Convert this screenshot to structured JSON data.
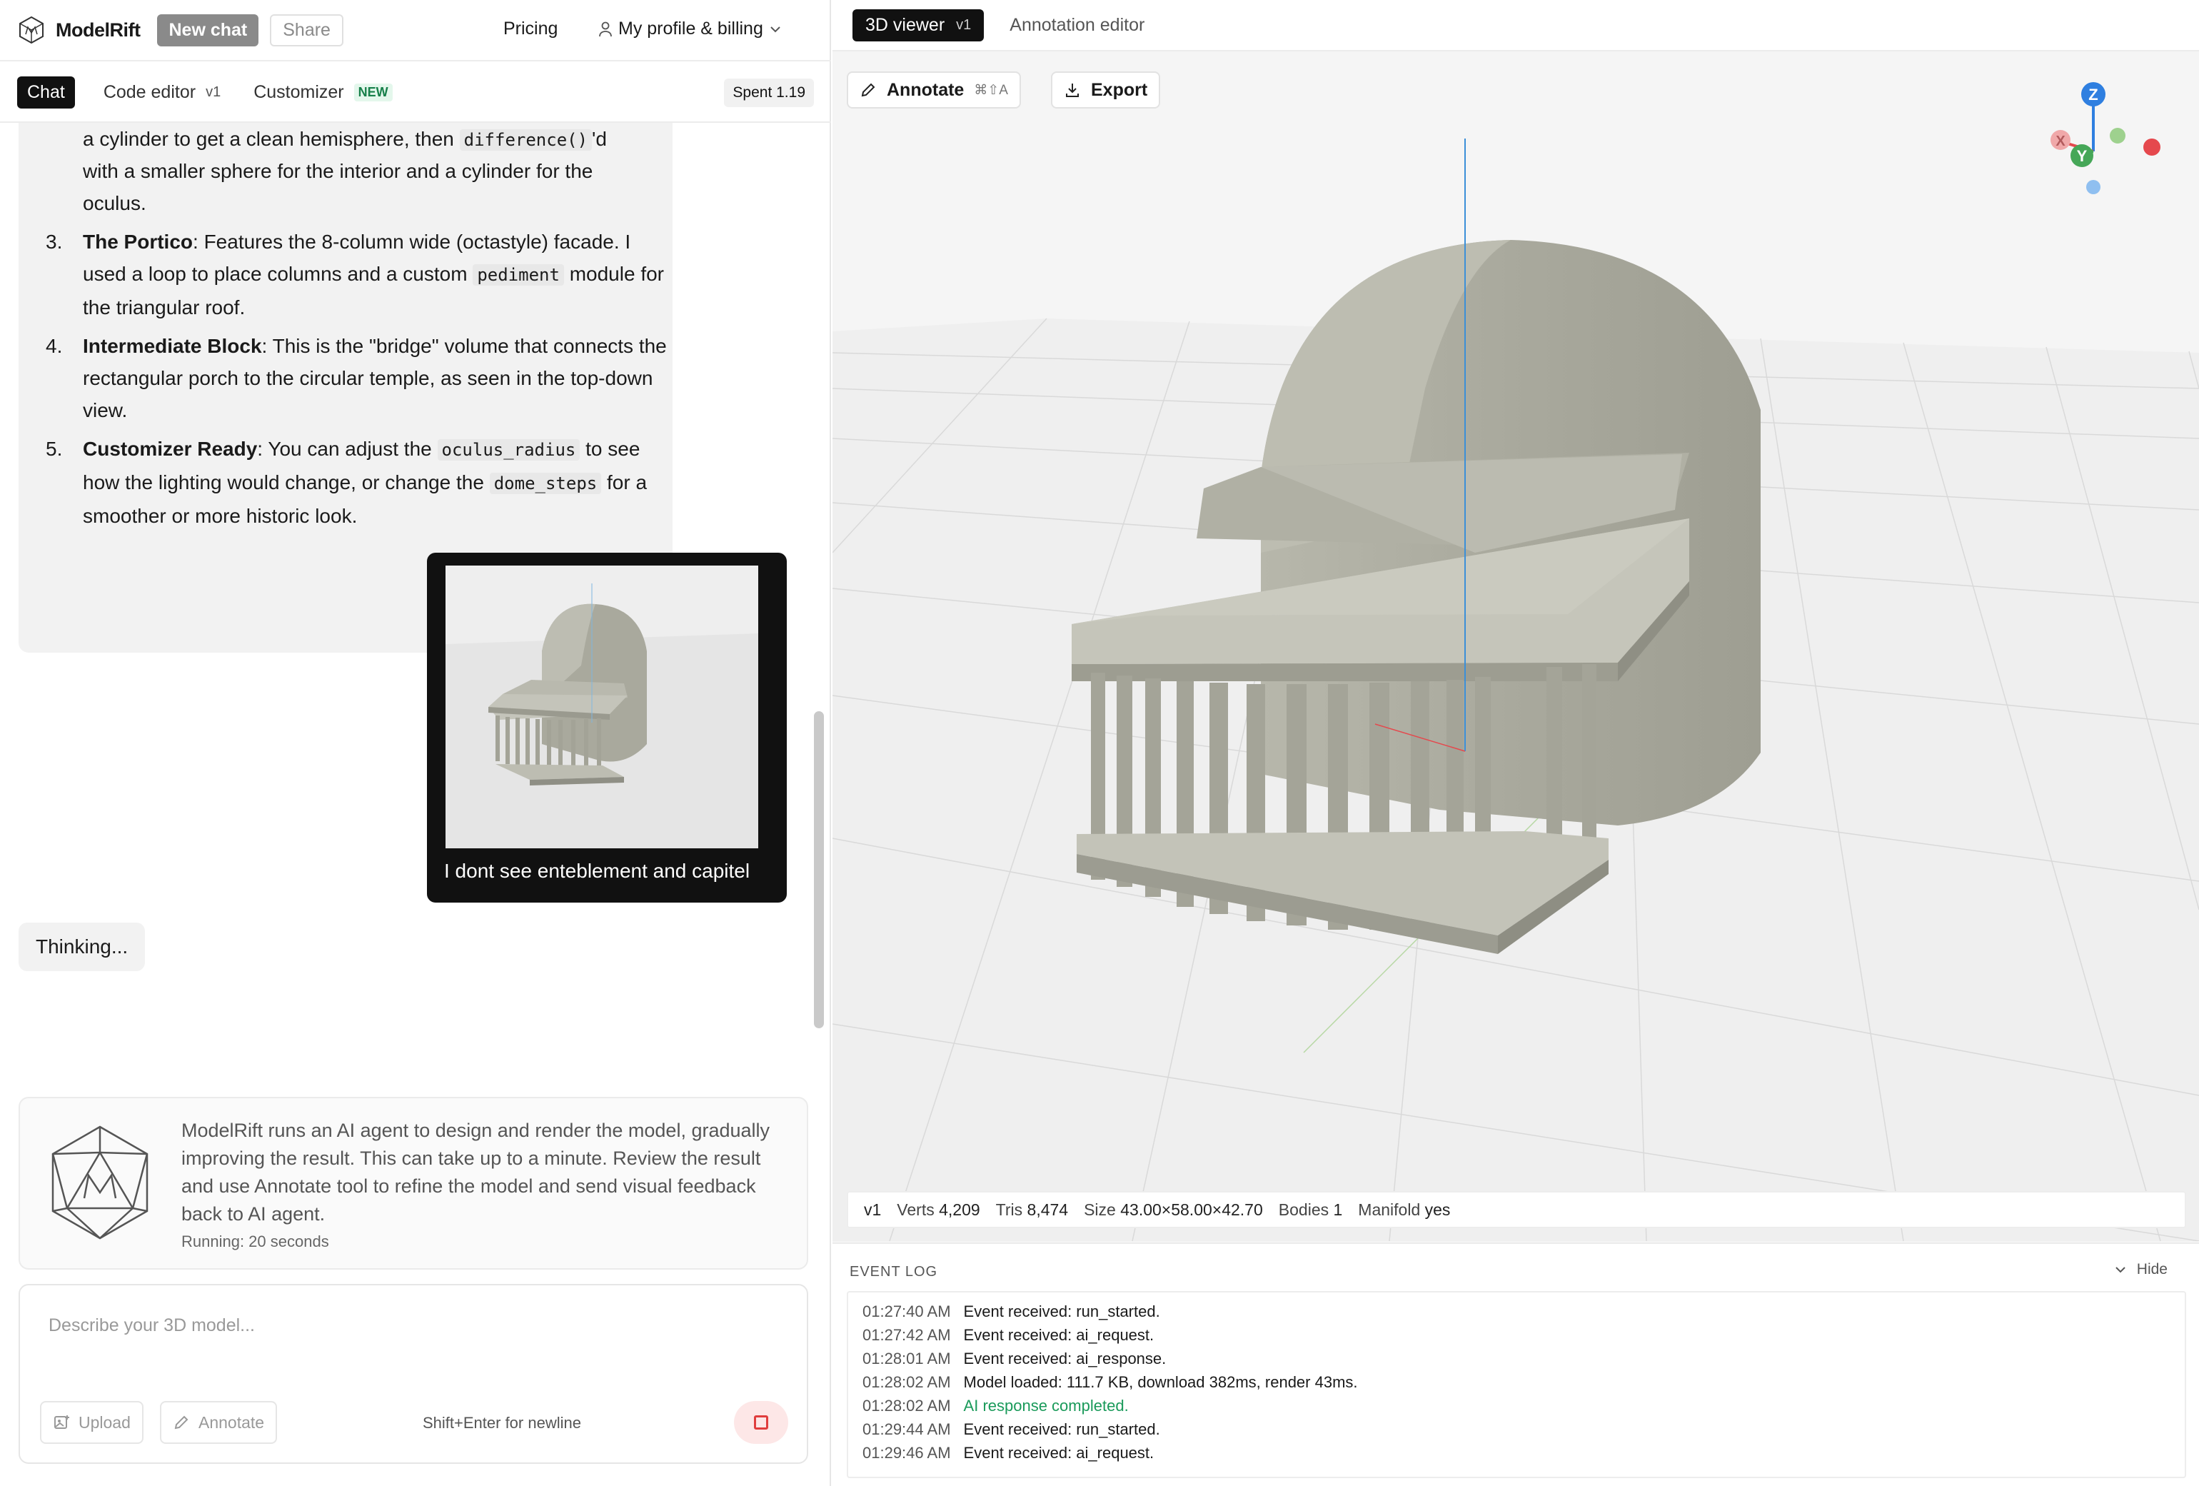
{
  "app": {
    "brand": "ModelRift"
  },
  "topbar": {
    "new_chat": "New chat",
    "share": "Share",
    "pricing": "Pricing",
    "profile": "My profile & billing"
  },
  "subbar": {
    "tabs": [
      {
        "label": "Chat",
        "active": true
      },
      {
        "label": "Code editor",
        "version": "v1"
      },
      {
        "label": "Customizer",
        "badge": "NEW"
      }
    ],
    "spent": "Spent 1.19"
  },
  "chat": {
    "ai_message": {
      "item2_tail_a": "a cylinder to get a clean hemisphere, then ",
      "item2_code": "difference()",
      "item2_tail_b": "'d",
      "item2_tail_c": "with a smaller sphere for the interior and a cylinder for the",
      "item2_tail_d": "oculus.",
      "items": [
        {
          "num": "3.",
          "title": "The Portico",
          "text_a": ": Features the 8-column wide (octastyle) facade. I used a loop to place columns and a custom ",
          "code": "pediment",
          "text_b": " module for the triangular roof."
        },
        {
          "num": "4.",
          "title": "Intermediate Block",
          "text_a": ": This is the \"bridge\" volume that connects the rectangular porch to the circular temple, as seen in the top-down view."
        },
        {
          "num": "5.",
          "title": "Customizer Ready",
          "text_a": ": You can adjust the ",
          "code": "oculus_radius",
          "text_b": " to see how the lighting would change, or change the ",
          "code2": "dome_steps",
          "text_c": " for a smoother or more historic look."
        }
      ]
    },
    "user_message": {
      "text": "I dont see enteblement and capitel"
    },
    "thinking": "Thinking..."
  },
  "info": {
    "text": "ModelRift runs an AI agent to design and render the model, gradually improving the result. This can take up to a minute. Review the result and use Annotate tool to refine the model and send visual feedback back to AI agent.",
    "running": "Running: 20 seconds"
  },
  "composer": {
    "placeholder": "Describe your 3D model...",
    "upload": "Upload",
    "annotate": "Annotate",
    "hint": "Shift+Enter for newline"
  },
  "viewer": {
    "tabs": [
      {
        "label": "3D viewer",
        "version": "v1",
        "active": true
      },
      {
        "label": "Annotation editor"
      }
    ],
    "annotate": "Annotate",
    "annotate_kbd": "⌘⇧A",
    "export": "Export",
    "axes": {
      "z": "Z",
      "y": "Y",
      "x": "X"
    },
    "stats": {
      "version": "v1",
      "verts_label": "Verts",
      "verts": "4,209",
      "tris_label": "Tris",
      "tris": "8,474",
      "size_label": "Size",
      "size": "43.00×58.00×42.70",
      "bodies_label": "Bodies",
      "bodies": "1",
      "manifold_label": "Manifold",
      "manifold": "yes"
    }
  },
  "event_log": {
    "title": "EVENT LOG",
    "hide": "Hide",
    "rows": [
      {
        "time": "01:27:40 AM",
        "msg": "Event received: run_started.",
        "ok": false
      },
      {
        "time": "01:27:42 AM",
        "msg": "Event received: ai_request.",
        "ok": false
      },
      {
        "time": "01:28:01 AM",
        "msg": "Event received: ai_response.",
        "ok": false
      },
      {
        "time": "01:28:02 AM",
        "msg": "Model loaded: 111.7 KB, download 382ms, render 43ms.",
        "ok": false
      },
      {
        "time": "01:28:02 AM",
        "msg": "AI response completed.",
        "ok": true
      },
      {
        "time": "01:29:44 AM",
        "msg": "Event received: run_started.",
        "ok": false
      },
      {
        "time": "01:29:46 AM",
        "msg": "Event received: ai_request.",
        "ok": false
      }
    ]
  },
  "colors": {
    "accent": "#111111",
    "success": "#1a9a5a",
    "stop": "#e03e3e",
    "model": "#a9a99d",
    "axis_x": "#e5484d",
    "axis_y": "#46a758",
    "axis_z": "#2f7fe0"
  }
}
